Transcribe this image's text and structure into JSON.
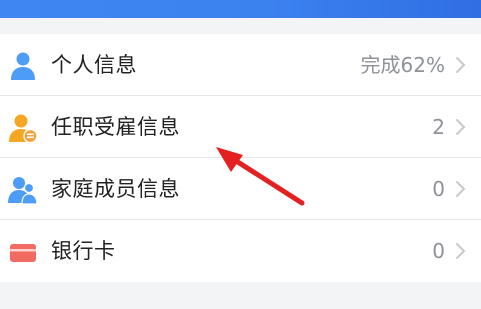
{
  "rows": [
    {
      "label": "个人信息",
      "value": "完成62%",
      "icon": "person-blue-icon",
      "icon_color": "#4d9cf5"
    },
    {
      "label": "任职受雇信息",
      "value": "2",
      "icon": "person-work-orange-icon",
      "icon_color": "#f5a623"
    },
    {
      "label": "家庭成员信息",
      "value": "0",
      "icon": "family-members-blue-icon",
      "icon_color": "#4d9cf5"
    },
    {
      "label": "银行卡",
      "value": "0",
      "icon": "bank-card-red-icon",
      "icon_color": "#f26b63"
    }
  ],
  "annotation": {
    "arrow_color": "#e52020"
  }
}
